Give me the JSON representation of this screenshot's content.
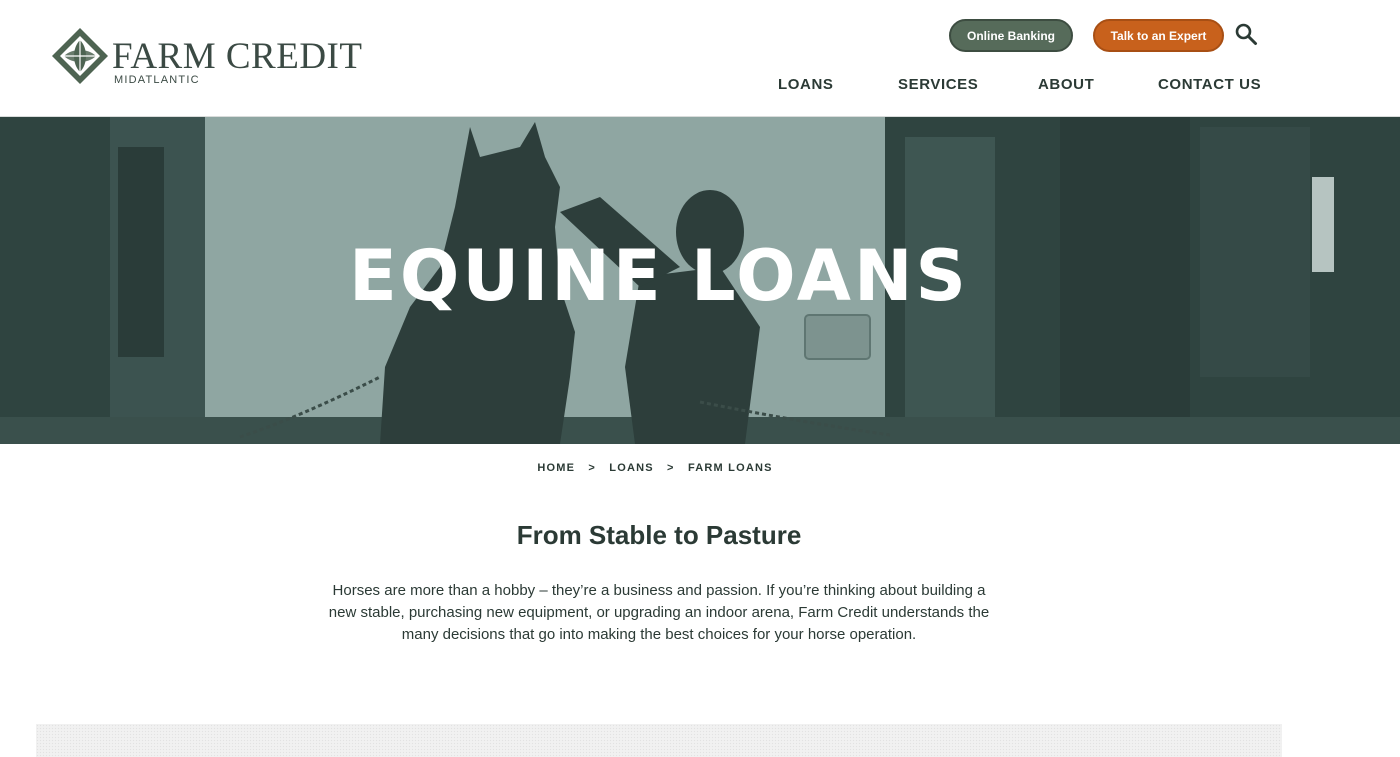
{
  "header": {
    "logo": {
      "name": "FARM CREDIT",
      "sub": "MIDATLANTIC"
    },
    "buttons": {
      "online_banking": "Online Banking",
      "talk_expert": "Talk to an Expert"
    },
    "nav": [
      "LOANS",
      "SERVICES",
      "ABOUT",
      "CONTACT US"
    ],
    "icons": {
      "search": "search-icon",
      "logo": "diamond-leaf-logo-icon"
    }
  },
  "hero": {
    "title": "EQUINE LOANS"
  },
  "breadcrumb": [
    "HOME",
    "LOANS",
    "FARM LOANS"
  ],
  "breadcrumb_separator": ">",
  "content": {
    "heading": "From Stable to Pasture",
    "body": "Horses are more than a hobby – they’re a business and passion. If you’re thinking about building a new stable, purchasing new equipment, or upgrading an indoor arena, Farm Credit understands the many decisions that go into making the best choices for your horse operation."
  },
  "colors": {
    "brand_dark": "#2b3a35",
    "banking_button": "#566b5a",
    "expert_button": "#c8611c",
    "hero_overlay": "#3a4f4b"
  }
}
